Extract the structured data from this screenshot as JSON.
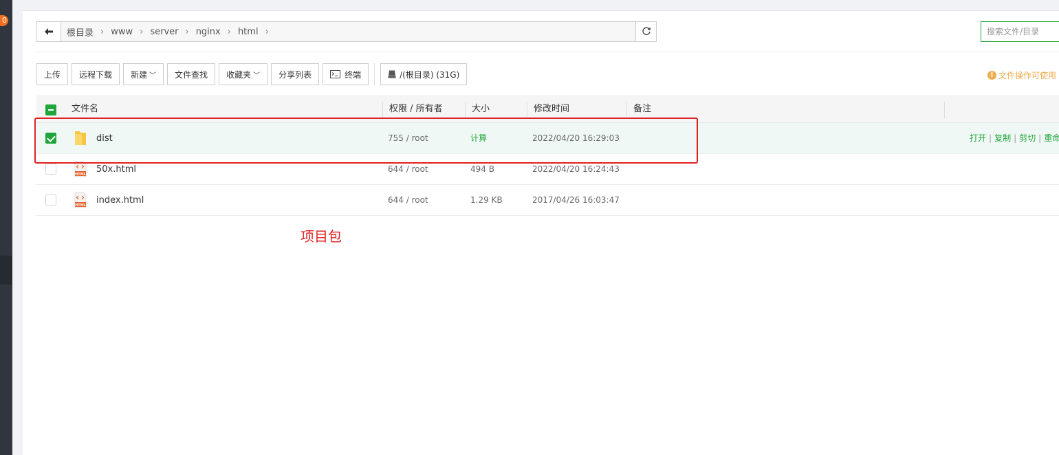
{
  "sidebar": {
    "badge": "0"
  },
  "breadcrumb": {
    "items": [
      "根目录",
      "www",
      "server",
      "nginx",
      "html"
    ],
    "separator": "›"
  },
  "search": {
    "placeholder": "搜索文件/目录"
  },
  "toolbar": {
    "upload": "上传",
    "remote_download": "远程下载",
    "new": "新建",
    "file_search": "文件查找",
    "favorites": "收藏夹",
    "share_list": "分享列表",
    "terminal": "终端",
    "disk": "/(根目录) (31G)"
  },
  "tip": "文件操作可使用",
  "table": {
    "headers": {
      "name": "文件名",
      "perm": "权限 / 所有者",
      "size": "大小",
      "mtime": "修改时间",
      "note": "备注"
    },
    "rows": [
      {
        "name": "dist",
        "perm": "755 / root",
        "size": "计算",
        "mtime": "2022/04/20 16:29:03",
        "type": "folder",
        "checked": true
      },
      {
        "name": "50x.html",
        "perm": "644 / root",
        "size": "494 B",
        "mtime": "2022/04/20 16:24:43",
        "type": "html",
        "checked": false
      },
      {
        "name": "index.html",
        "perm": "644 / root",
        "size": "1.29 KB",
        "mtime": "2017/04/26 16:03:47",
        "type": "html",
        "checked": false
      }
    ],
    "ops": {
      "open": "打开",
      "copy": "复制",
      "cut": "剪切",
      "rename": "重命名"
    }
  },
  "annotation": "项目包",
  "colors": {
    "accent": "#20a53a",
    "annotation": "#e02020",
    "tip": "#f0ad4e",
    "sidebar": "#31353d"
  }
}
